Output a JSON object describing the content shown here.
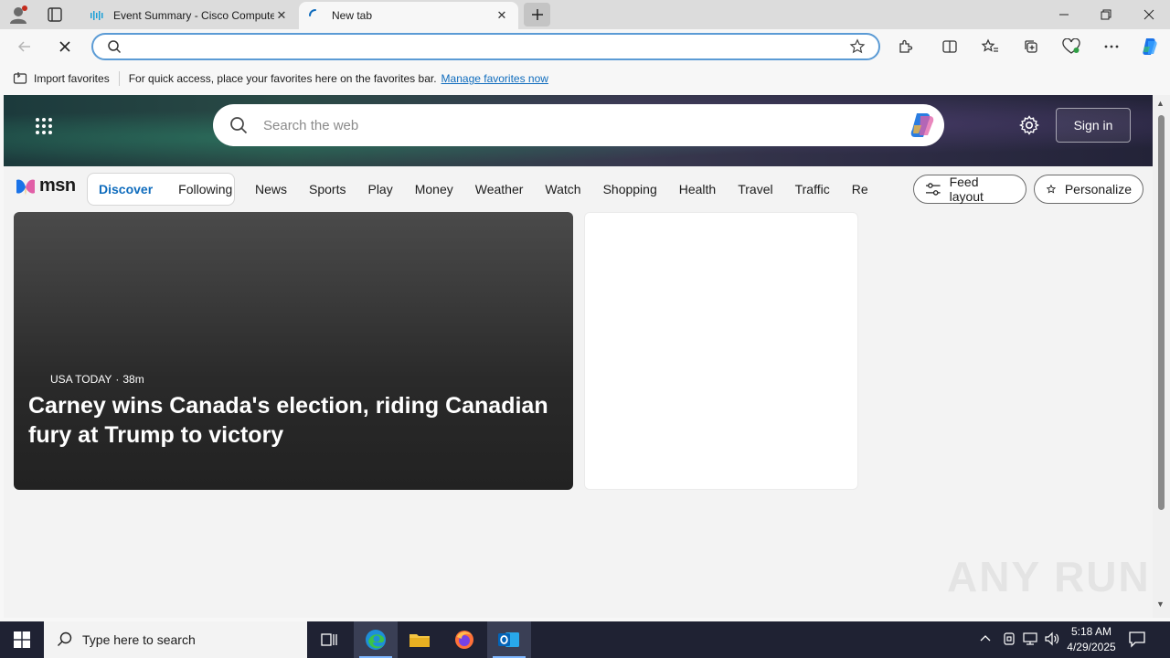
{
  "tabs": [
    {
      "title": "Event Summary - Cisco Computer",
      "state": "inactive"
    },
    {
      "title": "New tab",
      "state": "active"
    }
  ],
  "address_bar": {
    "value": "",
    "placeholder": ""
  },
  "favorites_bar": {
    "import_label": "Import favorites",
    "message": "For quick access, place your favorites here on the favorites bar.",
    "manage_link": "Manage favorites now"
  },
  "msn": {
    "search_placeholder": "Search the web",
    "sign_in": "Sign in",
    "logo_text": "msn",
    "segments": {
      "discover": "Discover",
      "following": "Following"
    },
    "categories": [
      "News",
      "Sports",
      "Play",
      "Money",
      "Weather",
      "Watch",
      "Shopping",
      "Health",
      "Travel",
      "Traffic",
      "Real E"
    ],
    "feed_layout": "Feed layout",
    "personalize": "Personalize",
    "top_story": {
      "source": "USA TODAY",
      "age": "38m",
      "title": "Carney wins Canada's election, riding Canadian fury at Trump to victory"
    }
  },
  "watermark": "ANY RUN",
  "taskbar": {
    "search_placeholder": "Type here to search",
    "time": "5:18 AM",
    "date": "4/29/2025"
  },
  "colors": {
    "accent": "#0f6cbd",
    "taskbar": "#1f2233",
    "address_focus": "#5b9bd5"
  }
}
